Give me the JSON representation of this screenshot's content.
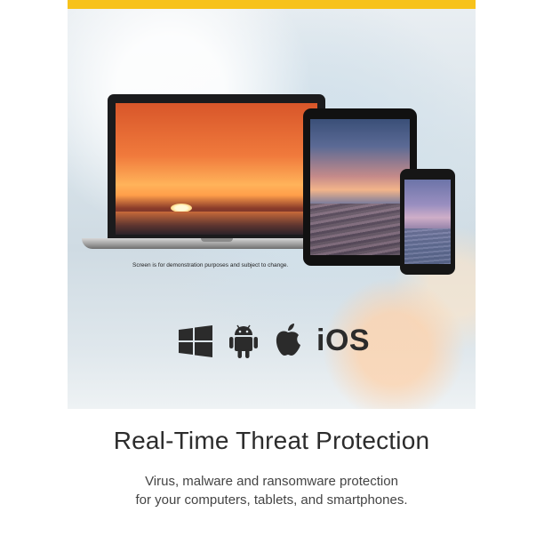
{
  "banner": {
    "accent_color": "#f7c21b",
    "disclaimer": "Screen is for demonstration purposes and subject to change.",
    "devices": [
      "laptop",
      "tablet",
      "smartphone"
    ],
    "platform_icons": [
      "windows-icon",
      "android-icon",
      "apple-icon"
    ],
    "ios_label": "iOS",
    "title": "Real-Time Threat Protection",
    "subtitle_line1": "Virus, malware and ransomware protection",
    "subtitle_line2": "for your computers,  tablets, and smartphones."
  }
}
